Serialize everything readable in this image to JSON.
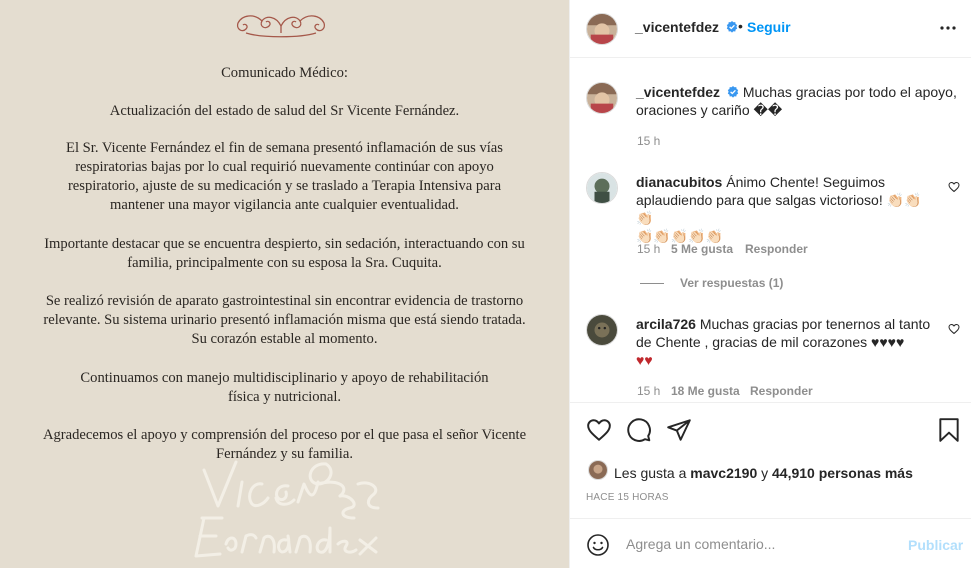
{
  "letter": {
    "title": "Comunicado Médico:",
    "subtitle": "Actualización del estado de salud del Sr Vicente Fernández.",
    "p1": [
      "El Sr. Vicente Fernández el fin de semana presentó inflamación de sus vías",
      "respiratorias bajas por lo cual requirió nuevamente continúar con apoyo",
      "respiratorio, ajuste de su medicación y se traslado a Terapia Intensiva para",
      "mantener una mayor vigilancia ante cualquier eventualidad."
    ],
    "p2": [
      "Importante destacar que se encuentra despierto, sin sedación, interactuando con su",
      "familia, principalmente con su esposa la Sra. Cuquita."
    ],
    "p3": [
      "Se realizó revisión de aparato gastrointestinal sin encontrar evidencia de trastorno",
      "relevante. Su sistema urinario presentó inflamación misma que está siendo tratada.",
      "Su corazón estable al momento."
    ],
    "p4": [
      "Continuamos con manejo multidisciplinario y apoyo de rehabilitación",
      "física y nutricional."
    ],
    "p5": [
      "Agradecemos el apoyo y comprensión del proceso por el que pasa el señor Vicente",
      "Fernández y su familia."
    ],
    "signature": "Vicente Fernandez"
  },
  "header": {
    "username": "_vicentefdez",
    "dot": "•",
    "follow_label": "Seguir"
  },
  "caption": {
    "username": "_vicentefdez",
    "text_line1": "Muchas gracias por todo el apoyo,",
    "text_line2": "oraciones y cariño ��",
    "time": "15 h"
  },
  "comments": [
    {
      "username": "dianacubitos",
      "line1": "Ánimo Chente! Seguimos",
      "line2": "aplaudiendo para que salgas victorioso! 👏🏻👏🏻👏🏻",
      "line3": "👏🏻👏🏻👏🏻👏🏻👏🏻",
      "time": "15 h",
      "likes": "5 Me gusta",
      "reply": "Responder",
      "see_replies": "Ver respuestas (1)"
    },
    {
      "username": "arcila726",
      "line1": "Muchas gracias por tenernos al tanto",
      "line2": "de Chente , gracias de mil corazones ♥♥♥♥",
      "line3": "♥♥",
      "time": "15 h",
      "likes": "18 Me gusta",
      "reply": "Responder"
    }
  ],
  "likes": {
    "prefix": "Les gusta a",
    "user": "mavc2190",
    "conj": "y",
    "count": "44,910 personas más"
  },
  "time_ago": "HACE 15 HORAS",
  "add_comment": {
    "placeholder": "Agrega un comentario...",
    "publish_label": "Publicar"
  },
  "icons": {
    "more": "more-horizontal-icon",
    "verified": "verified-badge-icon",
    "like": "heart-icon",
    "comment": "comment-icon",
    "share": "share-icon",
    "save": "bookmark-icon",
    "emoji": "emoji-icon"
  },
  "colors": {
    "accent": "#0095f6",
    "letter_bg": "#e4ddd0",
    "heart_red": "#c0282d"
  }
}
